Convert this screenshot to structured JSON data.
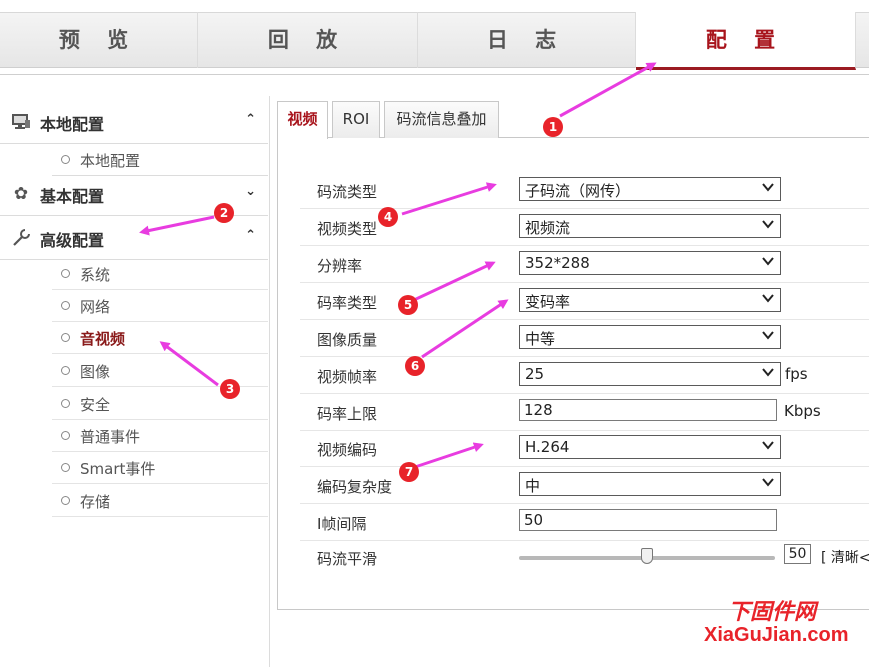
{
  "top_tabs": [
    {
      "label": "预 览"
    },
    {
      "label": "回 放"
    },
    {
      "label": "日 志"
    },
    {
      "label": "配 置"
    }
  ],
  "sidebar": {
    "local": {
      "label": "本地配置",
      "icon": "monitor-icon",
      "items": [
        {
          "label": "本地配置"
        }
      ]
    },
    "basic": {
      "label": "基本配置",
      "icon": "gear-icon"
    },
    "advanced": {
      "label": "高级配置",
      "icon": "wrench-icon",
      "items": [
        {
          "label": "系统"
        },
        {
          "label": "网络"
        },
        {
          "label": "音视频"
        },
        {
          "label": "图像"
        },
        {
          "label": "安全"
        },
        {
          "label": "普通事件"
        },
        {
          "label": "Smart事件"
        },
        {
          "label": "存储"
        }
      ]
    }
  },
  "content_tabs": [
    {
      "label": "视频"
    },
    {
      "label": "ROI"
    },
    {
      "label": "码流信息叠加"
    }
  ],
  "form": {
    "stream_type": {
      "label": "码流类型",
      "value": "子码流（网传）"
    },
    "video_type": {
      "label": "视频类型",
      "value": "视频流"
    },
    "resolution": {
      "label": "分辨率",
      "value": "352*288"
    },
    "bitrate_type": {
      "label": "码率类型",
      "value": "变码率"
    },
    "image_quality": {
      "label": "图像质量",
      "value": "中等"
    },
    "frame_rate": {
      "label": "视频帧率",
      "value": "25",
      "unit": "fps"
    },
    "max_bitrate": {
      "label": "码率上限",
      "value": "128",
      "unit": "Kbps"
    },
    "video_encoding": {
      "label": "视频编码",
      "value": "H.264"
    },
    "encoding_complexity": {
      "label": "编码复杂度",
      "value": "中"
    },
    "i_frame_interval": {
      "label": "I帧间隔",
      "value": "50"
    },
    "stream_smoothing": {
      "label": "码流平滑",
      "value": "50",
      "level": 0.5,
      "hint": "[ 清晰<"
    }
  },
  "annotations": [
    "1",
    "2",
    "3",
    "4",
    "5",
    "6",
    "7"
  ],
  "watermark": {
    "line1": "下固件网",
    "line2": "XiaGuJian.com"
  },
  "colors": {
    "accent": "#a8141c",
    "arrow": "#e83ce0",
    "badge": "#e8232a"
  }
}
